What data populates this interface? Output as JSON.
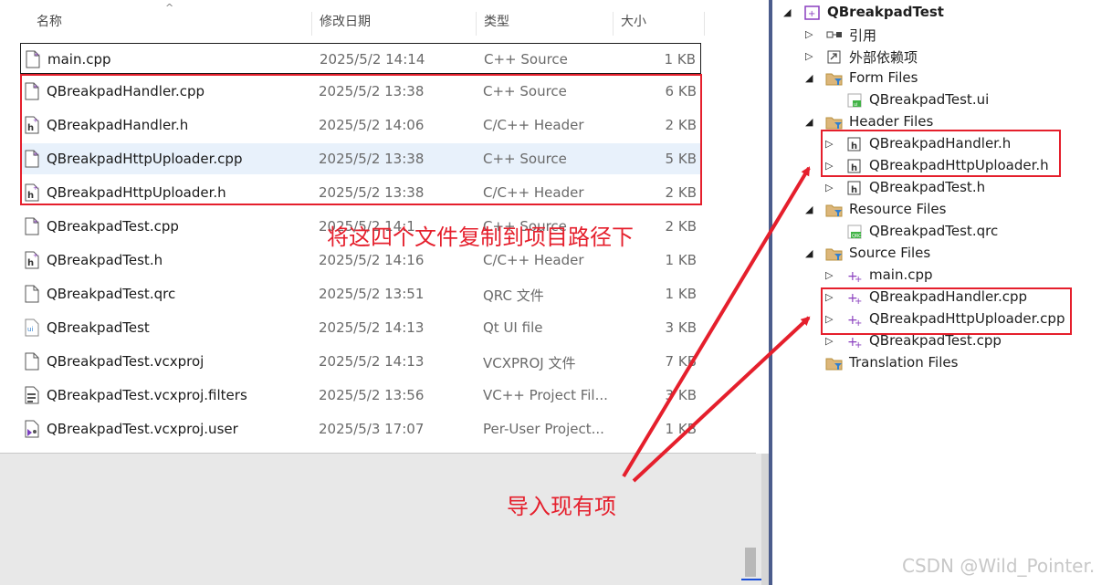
{
  "explorer": {
    "columns": {
      "name": "名称",
      "date": "修改日期",
      "type": "类型",
      "size": "大小"
    },
    "files": [
      {
        "name": "main.cpp",
        "date": "2025/5/2 14:14",
        "type": "C++ Source",
        "size": "1 KB",
        "icon": "cpp-file-icon",
        "state": "focused"
      },
      {
        "name": "QBreakpadHandler.cpp",
        "date": "2025/5/2 13:38",
        "type": "C++ Source",
        "size": "6 KB",
        "icon": "cpp-file-icon",
        "state": ""
      },
      {
        "name": "QBreakpadHandler.h",
        "date": "2025/5/2 14:06",
        "type": "C/C++ Header",
        "size": "2 KB",
        "icon": "header-file-icon",
        "state": ""
      },
      {
        "name": "QBreakpadHttpUploader.cpp",
        "date": "2025/5/2 13:38",
        "type": "C++ Source",
        "size": "5 KB",
        "icon": "cpp-file-icon",
        "state": "hover"
      },
      {
        "name": "QBreakpadHttpUploader.h",
        "date": "2025/5/2 13:38",
        "type": "C/C++ Header",
        "size": "2 KB",
        "icon": "header-file-icon",
        "state": ""
      },
      {
        "name": "QBreakpadTest.cpp",
        "date": "2025/5/2 14:1",
        "type": "C++ Source",
        "size": "2 KB",
        "icon": "cpp-file-icon",
        "state": ""
      },
      {
        "name": "QBreakpadTest.h",
        "date": "2025/5/2 14:16",
        "type": "C/C++ Header",
        "size": "1 KB",
        "icon": "header-file-icon",
        "state": ""
      },
      {
        "name": "QBreakpadTest.qrc",
        "date": "2025/5/2 13:51",
        "type": "QRC 文件",
        "size": "1 KB",
        "icon": "blank-file-icon",
        "state": ""
      },
      {
        "name": "QBreakpadTest",
        "date": "2025/5/2 14:13",
        "type": "Qt UI file",
        "size": "3 KB",
        "icon": "ui-file-icon",
        "state": ""
      },
      {
        "name": "QBreakpadTest.vcxproj",
        "date": "2025/5/2 14:13",
        "type": "VCXPROJ 文件",
        "size": "7 KB",
        "icon": "blank-file-icon",
        "state": ""
      },
      {
        "name": "QBreakpadTest.vcxproj.filters",
        "date": "2025/5/2 13:56",
        "type": "VC++ Project Fil...",
        "size": "3 KB",
        "icon": "filters-file-icon",
        "state": ""
      },
      {
        "name": "QBreakpadTest.vcxproj.user",
        "date": "2025/5/3 17:07",
        "type": "Per-User Project...",
        "size": "1 KB",
        "icon": "vs-user-file-icon",
        "state": ""
      }
    ]
  },
  "solution": {
    "nodes": [
      {
        "label": "QBreakpadTest",
        "indent": 0,
        "arrow": "expanded",
        "icon": "project-icon",
        "bold": true
      },
      {
        "label": "引用",
        "indent": 1,
        "arrow": "collapsed",
        "icon": "references-icon",
        "bold": false
      },
      {
        "label": "外部依赖项",
        "indent": 1,
        "arrow": "collapsed",
        "icon": "external-deps-icon",
        "bold": false
      },
      {
        "label": "Form Files",
        "indent": 1,
        "arrow": "expanded",
        "icon": "filter-folder-icon",
        "bold": false
      },
      {
        "label": "QBreakpadTest.ui",
        "indent": 2,
        "arrow": "none",
        "icon": "ui-form-icon",
        "bold": false
      },
      {
        "label": "Header Files",
        "indent": 1,
        "arrow": "expanded",
        "icon": "filter-folder-icon",
        "bold": false
      },
      {
        "label": "QBreakpadHandler.h",
        "indent": 2,
        "arrow": "collapsed",
        "icon": "header-file-icon",
        "bold": false
      },
      {
        "label": "QBreakpadHttpUploader.h",
        "indent": 2,
        "arrow": "collapsed",
        "icon": "header-file-icon",
        "bold": false
      },
      {
        "label": "QBreakpadTest.h",
        "indent": 2,
        "arrow": "collapsed",
        "icon": "header-file-icon",
        "bold": false
      },
      {
        "label": "Resource Files",
        "indent": 1,
        "arrow": "expanded",
        "icon": "filter-folder-icon",
        "bold": false
      },
      {
        "label": "QBreakpadTest.qrc",
        "indent": 2,
        "arrow": "none",
        "icon": "qrc-file-icon",
        "bold": false
      },
      {
        "label": "Source Files",
        "indent": 1,
        "arrow": "expanded",
        "icon": "filter-folder-icon",
        "bold": false
      },
      {
        "label": "main.cpp",
        "indent": 2,
        "arrow": "collapsed",
        "icon": "cpp-source-icon",
        "bold": false
      },
      {
        "label": "QBreakpadHandler.cpp",
        "indent": 2,
        "arrow": "collapsed",
        "icon": "cpp-source-icon",
        "bold": false
      },
      {
        "label": "QBreakpadHttpUploader.cpp",
        "indent": 2,
        "arrow": "collapsed",
        "icon": "cpp-source-icon",
        "bold": false
      },
      {
        "label": "QBreakpadTest.cpp",
        "indent": 2,
        "arrow": "collapsed",
        "icon": "cpp-source-icon",
        "bold": false
      },
      {
        "label": "Translation Files",
        "indent": 1,
        "arrow": "none",
        "icon": "filter-folder-icon",
        "bold": false
      }
    ]
  },
  "annotations": {
    "copy_note": "将这四个文件复制到项目路径下",
    "import_note": "导入现有项",
    "color": "#e51f2c"
  },
  "watermark": "CSDN @Wild_Pointer."
}
